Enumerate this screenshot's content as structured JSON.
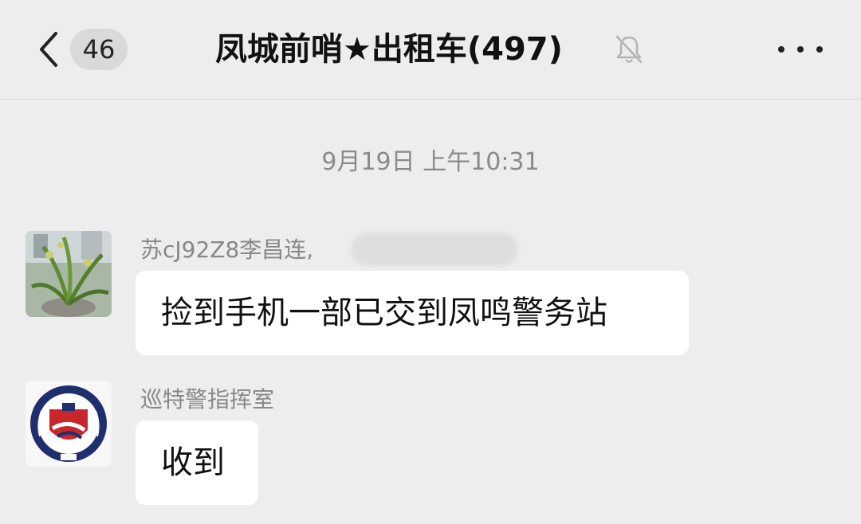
{
  "header": {
    "back_icon": "chevron-left-icon",
    "unread_count": "46",
    "title": "凤城前哨★出租车(497)",
    "mute_icon": "bell-off-icon",
    "more_icon": "more-horizontal-icon"
  },
  "chat": {
    "timestamp": "9月19日 上午10:31",
    "messages": [
      {
        "sender": "苏cJ92Z8李昌连,",
        "text": "捡到手机一部已交到凤鸣警务站",
        "avatar": "plant-photo-avatar"
      },
      {
        "sender": "巡特警指挥室",
        "text": "收到",
        "avatar": "police-emblem-avatar"
      }
    ]
  },
  "colors": {
    "background": "#ededed",
    "bubble": "#ffffff",
    "meta_text": "#8a8a8a",
    "emblem_blue": "#1f2f6e",
    "emblem_red": "#c8262b"
  }
}
